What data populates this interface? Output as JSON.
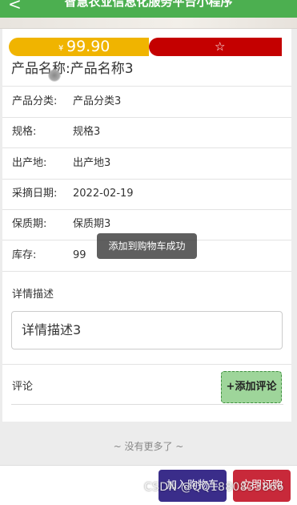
{
  "header": {
    "back_icon": "chevron-left-icon",
    "back_glyph": "<",
    "title": "智慧农业信息化服务平台小程序"
  },
  "price": {
    "currency": "¥",
    "value": "99.90",
    "favorite_icon": "star-outline-icon",
    "favorite_glyph": "☆"
  },
  "product": {
    "name_label": "产品名称:",
    "name_value": "产品名称3"
  },
  "info_rows": [
    {
      "label": "产品分类:",
      "value": "产品分类3"
    },
    {
      "label": "规格:",
      "value": "规格3"
    },
    {
      "label": "出产地:",
      "value": "出产地3"
    },
    {
      "label": "采摘日期:",
      "value": "2022-02-19"
    },
    {
      "label": "保质期:",
      "value": "保质期3"
    },
    {
      "label": "库存:",
      "value": "99"
    }
  ],
  "description": {
    "title": "详情描述",
    "value": "详情描述3"
  },
  "comments": {
    "label": "评论",
    "add_button": "+添加评论"
  },
  "list_end": "~ 没有更多了 ~",
  "footer": {
    "cart_button": "加入购物车",
    "buy_button": "立即订购"
  },
  "toast": "添加到购物车成功",
  "watermark": "CSDN @QQ1880833866",
  "colors": {
    "header": "#4caf50",
    "price_left": "#f0b400",
    "price_right": "#c40000",
    "cart": "#3a2d8a",
    "buy": "#c8293a",
    "add_comment": "#9ed59a"
  }
}
